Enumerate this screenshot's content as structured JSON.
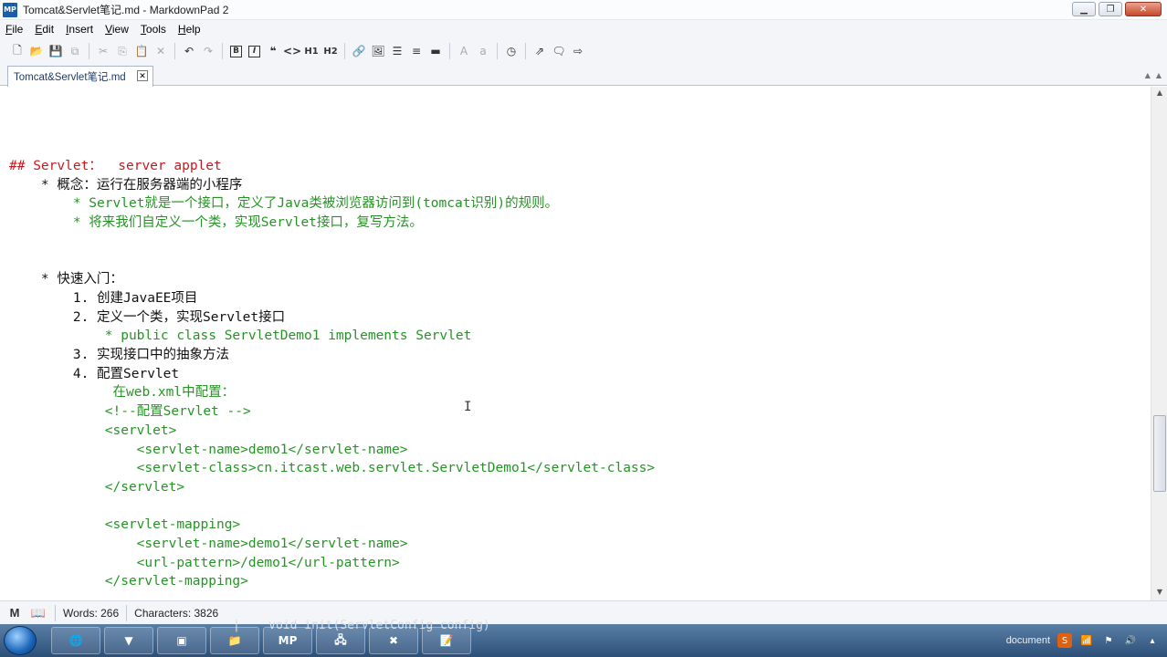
{
  "window": {
    "title": "Tomcat&Servlet笔记.md - MarkdownPad 2",
    "app_icon": "MP",
    "controls": [
      "minimize",
      "maximize",
      "close"
    ]
  },
  "menu": {
    "items": [
      "File",
      "Edit",
      "Insert",
      "View",
      "Tools",
      "Help"
    ],
    "accelerators": [
      "F",
      "E",
      "I",
      "V",
      "T",
      "H"
    ]
  },
  "toolbar": {
    "icons": [
      "new-file-icon",
      "open-folder-icon",
      "save-icon",
      "save-all-icon",
      "cut-icon",
      "copy-icon",
      "paste-icon",
      "delete-icon",
      "undo-icon",
      "redo-icon",
      "bold-icon",
      "italic-icon",
      "quote-icon",
      "code-icon",
      "h1-icon",
      "h2-icon",
      "link-icon",
      "image-icon",
      "bulleted-list-icon",
      "numbered-list-icon",
      "horizontal-rule-icon",
      "uppercase-icon",
      "lowercase-icon",
      "timestamp-icon",
      "preview-icon",
      "live-preview-icon",
      "export-icon"
    ],
    "bold_label": "B",
    "italic_label": "I",
    "h1_label": "H1",
    "h2_label": "H2",
    "upper_label": "A",
    "lower_label": "a"
  },
  "tabs": [
    {
      "label": "Tomcat&Servlet笔记.md",
      "active": true
    }
  ],
  "editor": {
    "lines": [
      {
        "text": "## Servlet：  server applet",
        "color": "red"
      },
      {
        "text": "    * 概念：运行在服务器端的小程序",
        "color": "black"
      },
      {
        "text": "        * Servlet就是一个接口，定义了Java类被浏览器访问到(tomcat识别)的规则。",
        "color": "green"
      },
      {
        "text": "        * 将来我们自定义一个类，实现Servlet接口，复写方法。",
        "color": "green"
      },
      {
        "text": "",
        "color": "black"
      },
      {
        "text": "",
        "color": "black"
      },
      {
        "text": "    * 快速入门：",
        "color": "black"
      },
      {
        "text": "        1. 创建JavaEE项目",
        "color": "black"
      },
      {
        "text": "        2. 定义一个类，实现Servlet接口",
        "color": "black"
      },
      {
        "text": "            * public class ServletDemo1 implements Servlet",
        "color": "green"
      },
      {
        "text": "        3. 实现接口中的抽象方法",
        "color": "black"
      },
      {
        "text": "        4. 配置Servlet",
        "color": "black"
      },
      {
        "text": "             在web.xml中配置：",
        "color": "green"
      },
      {
        "text": "            <!--配置Servlet -->",
        "color": "green"
      },
      {
        "text": "            <servlet>",
        "color": "green"
      },
      {
        "text": "                <servlet-name>demo1</servlet-name>",
        "color": "green"
      },
      {
        "text": "                <servlet-class>cn.itcast.web.servlet.ServletDemo1</servlet-class>",
        "color": "green"
      },
      {
        "text": "            </servlet>",
        "color": "green"
      },
      {
        "text": "",
        "color": "black"
      },
      {
        "text": "            <servlet-mapping>",
        "color": "green"
      },
      {
        "text": "                <servlet-name>demo1</servlet-name>",
        "color": "green"
      },
      {
        "text": "                <url-pattern>/demo1</url-pattern>",
        "color": "green"
      },
      {
        "text": "            </servlet-mapping>",
        "color": "green"
      }
    ],
    "colors": {
      "red": "#c8181e",
      "black": "#111111",
      "green": "#259425"
    }
  },
  "status": {
    "markdown_icon": "M",
    "book_icon": "book-icon",
    "words_label": "Words: 266",
    "chars_label": "Characters: 3826"
  },
  "taskbar": {
    "behind_text": "|    void init(ServletConfig config)",
    "mp_label": "MP",
    "tray_text": "document"
  }
}
